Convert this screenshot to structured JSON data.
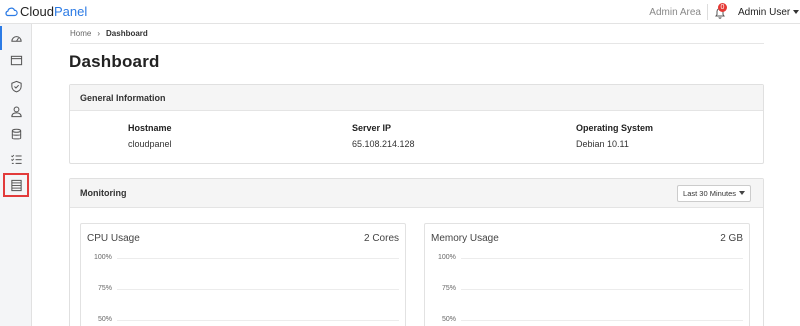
{
  "app": {
    "name_prefix": "Cloud",
    "name_suffix": "Panel",
    "accent_color": "#2c7be5"
  },
  "header": {
    "admin_area": "Admin Area",
    "notification_count": "0",
    "user_menu": "Admin User"
  },
  "sidebar": {
    "items": [
      {
        "icon": "dashboard-gauge-icon",
        "active": true
      },
      {
        "icon": "browser-window-icon"
      },
      {
        "icon": "shield-check-icon"
      },
      {
        "icon": "user-icon"
      },
      {
        "icon": "database-icon"
      },
      {
        "icon": "task-list-icon"
      },
      {
        "icon": "server-list-icon",
        "highlighted": true
      }
    ]
  },
  "breadcrumb": {
    "home": "Home",
    "current": "Dashboard"
  },
  "page": {
    "title": "Dashboard"
  },
  "general_info": {
    "header": "General Information",
    "hostname_label": "Hostname",
    "hostname_value": "cloudpanel",
    "server_ip_label": "Server IP",
    "server_ip_value": "65.108.214.128",
    "os_label": "Operating System",
    "os_value": "Debian 10.11"
  },
  "monitoring": {
    "header": "Monitoring",
    "range_selected": "Last 30 Minutes",
    "cpu": {
      "title": "CPU Usage",
      "meta": "2 Cores",
      "yticks": [
        "100%",
        "75%",
        "50%"
      ]
    },
    "memory": {
      "title": "Memory Usage",
      "meta": "2 GB",
      "yticks": [
        "100%",
        "75%",
        "50%"
      ]
    }
  }
}
